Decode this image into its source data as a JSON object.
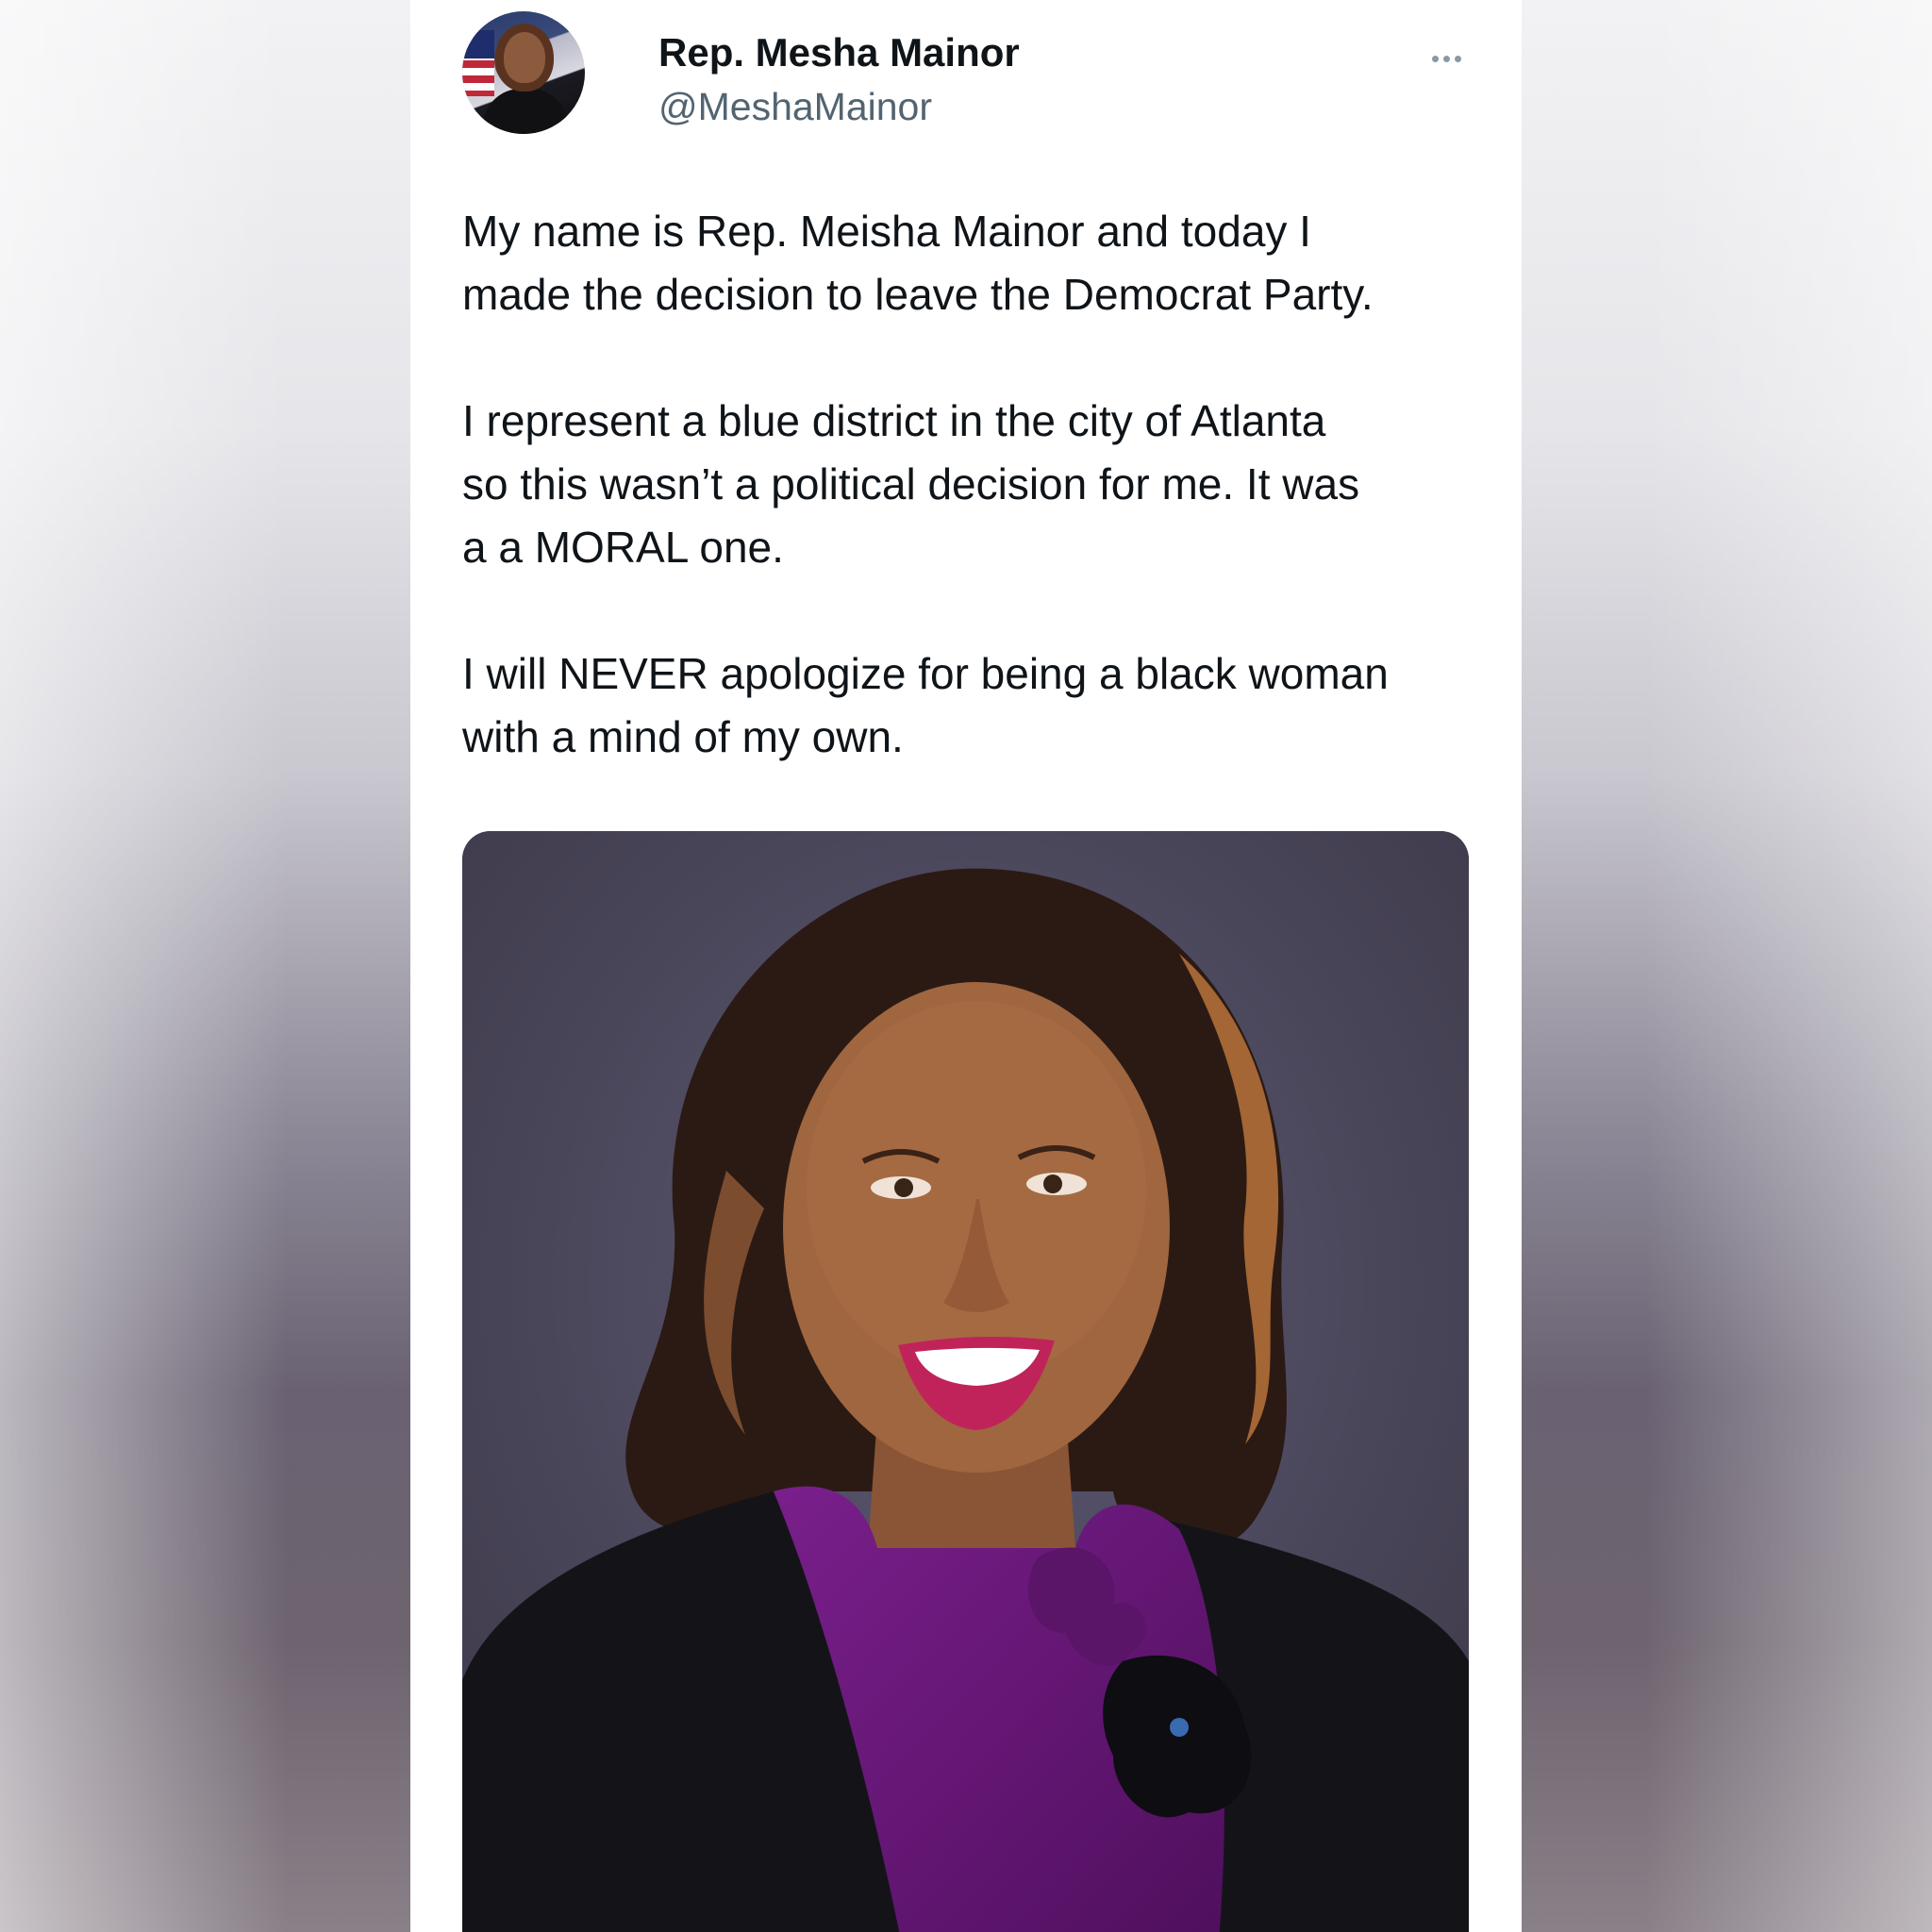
{
  "tweet": {
    "display_name": "Rep. Mesha Mainor",
    "handle": "@MeshaMainor",
    "more_icon": "more-options-icon",
    "paragraphs": [
      "My name is Rep. Meisha Mainor and today I\nmade the decision to leave the Democrat Party.",
      "I represent a blue district in the city of Atlanta\nso this wasn’t a political decision for me. It was\na a MORAL one.",
      "I will NEVER apologize for being a black woman\nwith a mind of my own."
    ]
  },
  "colors": {
    "text_primary": "#0f1419",
    "text_secondary": "#536471",
    "card_background": "#ffffff",
    "blouse": "#6a1a7a",
    "photo_background": "#4d4a5e"
  }
}
